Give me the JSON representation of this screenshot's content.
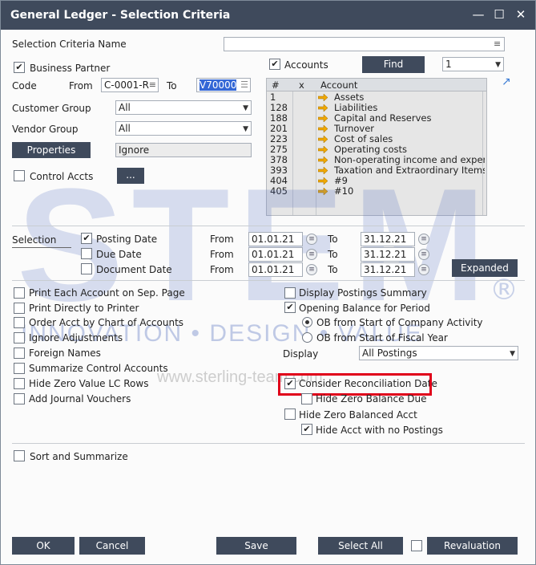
{
  "window": {
    "title": "General Ledger - Selection Criteria",
    "minimize": "—",
    "maximize": "☐",
    "close": "✕"
  },
  "criteria_name": {
    "label": "Selection Criteria Name",
    "value": ""
  },
  "business_partner": {
    "label": "Business Partner",
    "checked": true,
    "code_label": "Code",
    "from_label": "From",
    "from_value": "C-0001-R",
    "to_label": "To",
    "to_value": "V70000"
  },
  "customer_group": {
    "label": "Customer Group",
    "value": "All"
  },
  "vendor_group": {
    "label": "Vendor Group",
    "value": "All"
  },
  "properties": {
    "button": "Properties",
    "value": "Ignore"
  },
  "control_accts": {
    "label": "Control Accts",
    "button": "..."
  },
  "accounts": {
    "label": "Accounts",
    "checked": true,
    "find_button": "Find",
    "find_value": "1",
    "headers": {
      "num": "#",
      "x": "x",
      "account": "Account"
    },
    "rows": [
      {
        "num": "1",
        "name": "Assets"
      },
      {
        "num": "128",
        "name": "Liabilities"
      },
      {
        "num": "188",
        "name": "Capital and Reserves"
      },
      {
        "num": "201",
        "name": "Turnover"
      },
      {
        "num": "223",
        "name": "Cost of sales"
      },
      {
        "num": "275",
        "name": "Operating costs"
      },
      {
        "num": "378",
        "name": "Non-operating income and expenc"
      },
      {
        "num": "393",
        "name": "Taxation and Extraordinary Items"
      },
      {
        "num": "404",
        "name": "#9"
      },
      {
        "num": "405",
        "name": "#10"
      }
    ]
  },
  "selection": {
    "label": "Selection",
    "rows": [
      {
        "label": "Posting Date",
        "checked": true,
        "from": "01.01.21",
        "to": "31.12.21"
      },
      {
        "label": "Due Date",
        "checked": false,
        "from": "01.01.21",
        "to": "31.12.21"
      },
      {
        "label": "Document Date",
        "checked": false,
        "from": "01.01.21",
        "to": "31.12.21"
      }
    ],
    "from_label": "From",
    "to_label": "To",
    "expanded_button": "Expanded"
  },
  "options_left": [
    {
      "label": "Print Each Account on Sep. Page",
      "checked": false
    },
    {
      "label": "Print Directly to Printer",
      "checked": false
    },
    {
      "label": "Order Acct by Chart of Accounts",
      "checked": false
    },
    {
      "label": "Ignore Adjustments",
      "checked": false
    },
    {
      "label": "Foreign Names",
      "checked": false
    },
    {
      "label": "Summarize Control Accounts",
      "checked": false
    },
    {
      "label": "Hide Zero Value LC Rows",
      "checked": false
    },
    {
      "label": "Add Journal Vouchers",
      "checked": false
    }
  ],
  "options_right": {
    "display_postings_summary": "Display Postings Summary",
    "opening_balance": "Opening Balance for Period",
    "ob_company": "OB from Start of Company Activity",
    "ob_fiscal": "OB from Start of Fiscal Year",
    "display_label": "Display",
    "display_value": "All Postings",
    "consider_recon": "Consider Reconciliation Date",
    "hide_zero_due": "Hide Zero Balance Due",
    "hide_zero_acct": "Hide Zero Balanced Acct",
    "hide_no_postings": "Hide Acct with no Postings"
  },
  "sort_summarize": "Sort and Summarize",
  "watermark": {
    "brand": "STEM",
    "registered": "®",
    "tagline": "INNOVATION • DESIGN • VALUE",
    "url": "www.sterling-team.com"
  },
  "footer": {
    "ok": "OK",
    "cancel": "Cancel",
    "save": "Save",
    "select_all": "Select All",
    "revaluation": "Revaluation"
  },
  "colors": {
    "titlebar": "#3f4a5c",
    "button": "#3f4a5c",
    "highlight": "#e0001a",
    "arrow": "#f0a800"
  }
}
